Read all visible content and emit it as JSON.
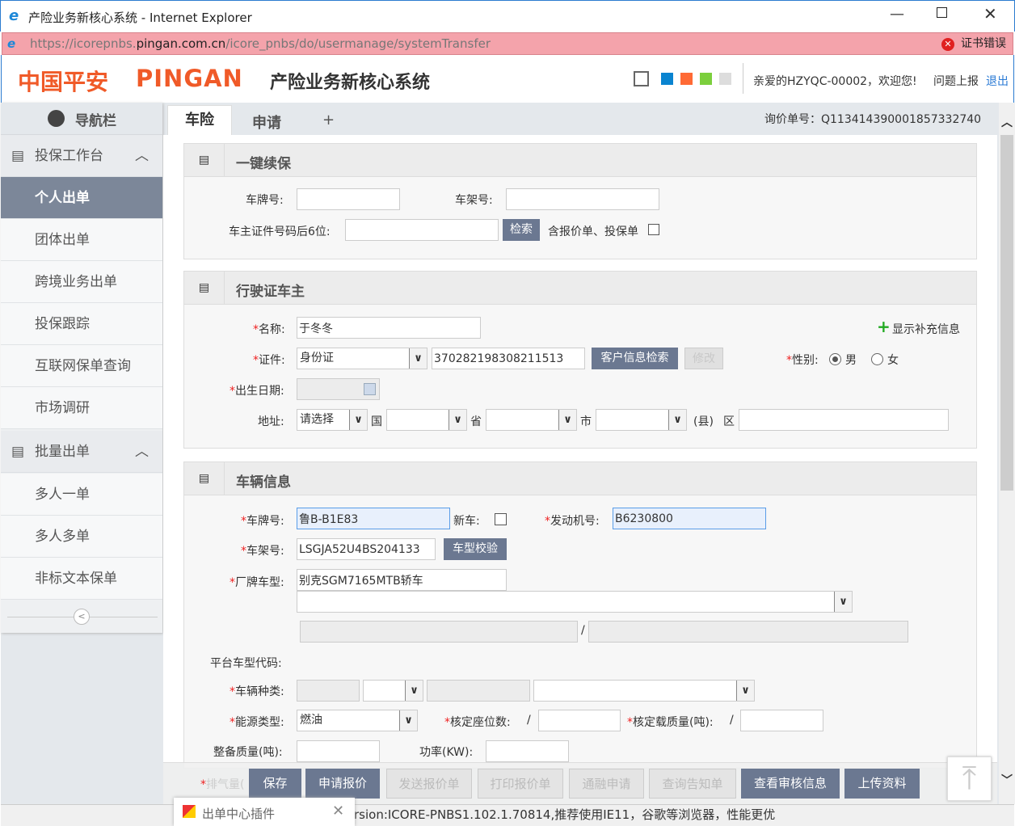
{
  "window": {
    "title": "产险业务新核心系统 - Internet Explorer",
    "url_prefix": "https://icorepnbs.",
    "url_domain": "pingan.com.cn",
    "url_path": "/icore_pnbs/do/usermanage/systemTransfer",
    "cert_error": "证书错误"
  },
  "header": {
    "logo_cn": "中国平安",
    "logo_en": "PINGAN",
    "system_name": "产险业务新核心系统",
    "welcome": "亲爱的HZYQC-00002，欢迎您!",
    "report": "问题上报",
    "logout": "退出",
    "theme_colors": [
      "#0a84d0",
      "#ff6a35",
      "#7ccf3d",
      "#dddddd"
    ]
  },
  "sidebar": {
    "title": "导航栏",
    "sections": [
      {
        "label": "投保工作台",
        "items": [
          "个人出单",
          "团体出单",
          "跨境业务出单",
          "投保跟踪",
          "互联网保单查询",
          "市场调研"
        ]
      },
      {
        "label": "批量出单",
        "items": [
          "多人一单",
          "多人多单",
          "非标文本保单"
        ]
      }
    ]
  },
  "tabs": [
    {
      "label": "车险",
      "active": true
    },
    {
      "label": "申请"
    },
    {
      "label": "+"
    }
  ],
  "quote_no_label": "询价单号：",
  "quote_no": "Q113414390001857332740",
  "renew": {
    "title": "一键续保",
    "plate_label": "车牌号:",
    "frame_label": "车架号:",
    "id_label": "车主证件号码后6位:",
    "search": "检索",
    "include": "含报价单、投保单"
  },
  "owner": {
    "title": "行驶证车主",
    "name_label": "名称:",
    "name": "于冬冬",
    "show_more": "显示补充信息",
    "id_label": "证件:",
    "id_type": "身份证",
    "id_no": "370282198308211513",
    "cust_search": "客户信息检索",
    "modify": "修改",
    "gender_label": "性别:",
    "male": "男",
    "female": "女",
    "gender": "男",
    "birth_label": "出生日期:",
    "addr_label": "地址:",
    "addr_select": "请选择",
    "country": "国",
    "province": "省",
    "city": "市",
    "county": "(县)",
    "district": "区"
  },
  "vehicle": {
    "title": "车辆信息",
    "plate_label": "车牌号:",
    "plate": "鲁B-B1E83",
    "new_car": "新车:",
    "engine_label": "发动机号:",
    "engine": "B6230800",
    "frame_label": "车架号:",
    "frame": "LSGJA52U4BS204133",
    "check": "车型校验",
    "model_label": "厂牌车型:",
    "model": "别克SGM7165MTB轿车",
    "slash": "/",
    "platform_label": "平台车型代码:",
    "type_label": "车辆种类:",
    "energy_label": "能源类型:",
    "energy": "燃油",
    "seats_label": "核定座位数:",
    "load_label": "核定载质量(吨):",
    "curb_label": "整备质量(吨):",
    "power_label": "功率(KW):",
    "exhaust_label": "排气量("
  },
  "footer": {
    "buttons": [
      {
        "label": "保存",
        "enabled": true
      },
      {
        "label": "申请报价",
        "enabled": true
      },
      {
        "label": "发送报价单",
        "enabled": false
      },
      {
        "label": "打印报价单",
        "enabled": false
      },
      {
        "label": "通融申请",
        "enabled": false
      },
      {
        "label": "查询告知单",
        "enabled": false
      },
      {
        "label": "查看审核信息",
        "enabled": true
      },
      {
        "label": "上传资料",
        "enabled": true
      }
    ]
  },
  "status": {
    "plugin": "出单中心插件",
    "version": "rsion:ICORE-PNBS1.102.1.70814,推荐使用IE11，谷歌等浏览器，性能更优"
  }
}
